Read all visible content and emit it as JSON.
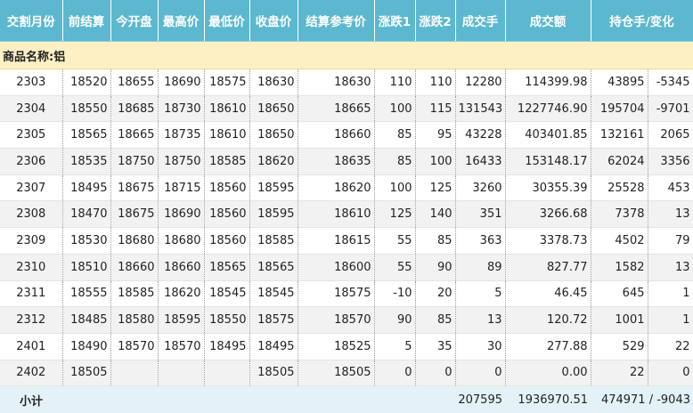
{
  "headers": [
    "交割月份",
    "前结算",
    "今开盘",
    "最高价",
    "最低价",
    "收盘价",
    "结算参考价",
    "涨跌1",
    "涨跌2",
    "成交手",
    "成交额",
    "持仓手/变化"
  ],
  "group_label": "商品名称:铝",
  "rows": [
    [
      "2303",
      "18520",
      "18655",
      "18690",
      "18575",
      "18630",
      "18630",
      "110",
      "110",
      "12280",
      "114399.98",
      "43895",
      "-5345"
    ],
    [
      "2304",
      "18550",
      "18685",
      "18730",
      "18610",
      "18650",
      "18665",
      "100",
      "115",
      "131543",
      "1227746.90",
      "195704",
      "-9701"
    ],
    [
      "2305",
      "18565",
      "18665",
      "18735",
      "18610",
      "18650",
      "18660",
      "85",
      "95",
      "43228",
      "403401.85",
      "132161",
      "2065"
    ],
    [
      "2306",
      "18535",
      "18750",
      "18750",
      "18585",
      "18620",
      "18635",
      "85",
      "100",
      "16433",
      "153148.17",
      "62024",
      "3356"
    ],
    [
      "2307",
      "18495",
      "18675",
      "18715",
      "18560",
      "18595",
      "18620",
      "100",
      "125",
      "3260",
      "30355.39",
      "25528",
      "453"
    ],
    [
      "2308",
      "18470",
      "18675",
      "18690",
      "18560",
      "18595",
      "18610",
      "125",
      "140",
      "351",
      "3266.68",
      "7378",
      "13"
    ],
    [
      "2309",
      "18530",
      "18680",
      "18680",
      "18560",
      "18585",
      "18615",
      "55",
      "85",
      "363",
      "3378.73",
      "4502",
      "79"
    ],
    [
      "2310",
      "18510",
      "18660",
      "18660",
      "18565",
      "18565",
      "18600",
      "55",
      "90",
      "89",
      "827.77",
      "1582",
      "13"
    ],
    [
      "2311",
      "18555",
      "18585",
      "18620",
      "18545",
      "18545",
      "18575",
      "-10",
      "20",
      "5",
      "46.45",
      "645",
      "1"
    ],
    [
      "2312",
      "18485",
      "18580",
      "18595",
      "18550",
      "18575",
      "18570",
      "90",
      "85",
      "13",
      "120.72",
      "1001",
      "1"
    ],
    [
      "2401",
      "18490",
      "18570",
      "18570",
      "18495",
      "18495",
      "18525",
      "5",
      "35",
      "30",
      "277.88",
      "529",
      "22"
    ],
    [
      "2402",
      "18505",
      "",
      "",
      "",
      "18505",
      "18505",
      "0",
      "0",
      "0",
      "0.00",
      "22",
      "0"
    ]
  ],
  "subtotal": {
    "label": "小计",
    "volume": "207595",
    "turnover": "1936970.51",
    "open_interest": "474971 / -9043"
  }
}
